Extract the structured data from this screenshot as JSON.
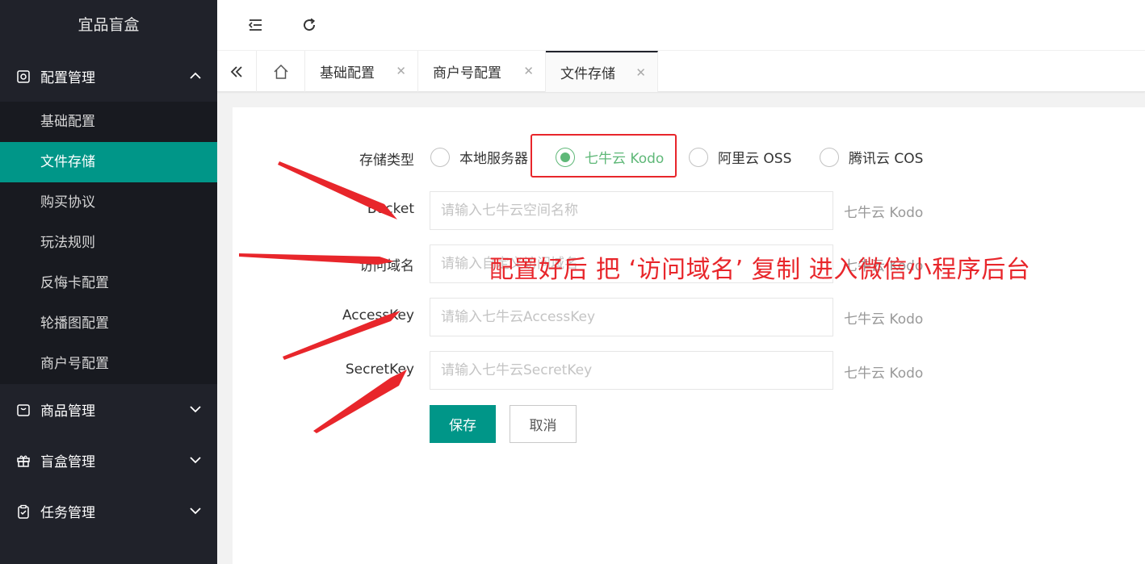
{
  "app": {
    "title": "宜品盲盒"
  },
  "sidebar": {
    "groups": [
      {
        "label": "配置管理",
        "icon": "settings-icon",
        "expanded": true,
        "items": [
          {
            "label": "基础配置"
          },
          {
            "label": "文件存储",
            "active": true
          },
          {
            "label": "购买协议"
          },
          {
            "label": "玩法规则"
          },
          {
            "label": "反悔卡配置"
          },
          {
            "label": "轮播图配置"
          },
          {
            "label": "商户号配置"
          }
        ]
      },
      {
        "label": "商品管理",
        "icon": "goods-icon",
        "expanded": false
      },
      {
        "label": "盲盒管理",
        "icon": "gift-icon",
        "expanded": false
      },
      {
        "label": "任务管理",
        "icon": "task-icon",
        "expanded": false
      }
    ]
  },
  "tabs": [
    {
      "label": "基础配置"
    },
    {
      "label": "商户号配置"
    },
    {
      "label": "文件存储",
      "active": true
    }
  ],
  "form": {
    "storage_type": {
      "label": "存储类型",
      "options": [
        {
          "label": "本地服务器",
          "checked": false
        },
        {
          "label": "七牛云 Kodo",
          "checked": true
        },
        {
          "label": "阿里云 OSS",
          "checked": false
        },
        {
          "label": "腾讯云 COS",
          "checked": false
        }
      ]
    },
    "fields": [
      {
        "label": "Bucket",
        "placeholder": "请输入七牛云空间名称",
        "aux": "七牛云 Kodo"
      },
      {
        "label": "访问域名",
        "placeholder": "请输入自定义访问域名",
        "aux": "七牛云 Kodo"
      },
      {
        "label": "AccessKey",
        "placeholder": "请输入七牛云AccessKey",
        "aux": "七牛云 Kodo"
      },
      {
        "label": "SecretKey",
        "placeholder": "请输入七牛云SecretKey",
        "aux": "七牛云 Kodo"
      }
    ],
    "save_label": "保存",
    "cancel_label": "取消"
  },
  "annotation": {
    "text": "配置好后 把 ‘访问域名’ 复制 进入微信小程序后台",
    "color": "#e8262b"
  },
  "colors": {
    "accent": "#009688",
    "sidebar": "#20222a",
    "checked": "#5fb878"
  }
}
